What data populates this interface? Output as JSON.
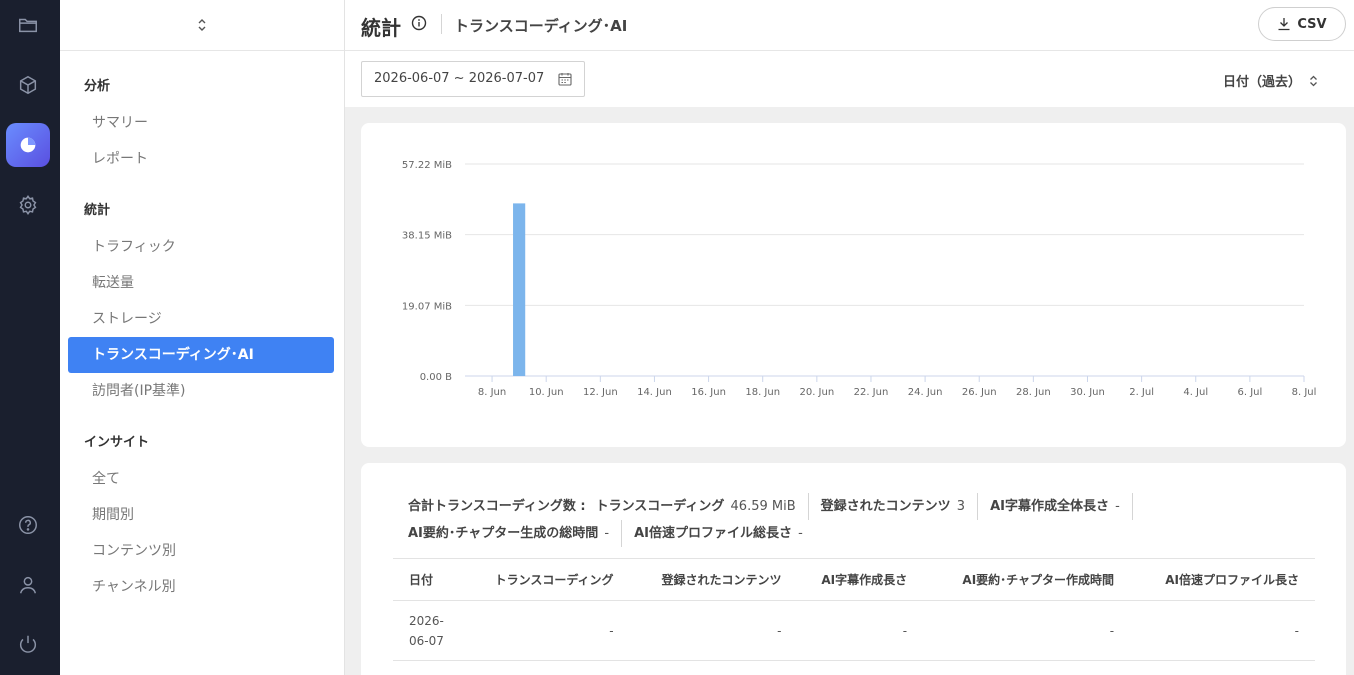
{
  "sidebar": {
    "sections": [
      {
        "title": "分析",
        "items": [
          "サマリー",
          "レポート"
        ]
      },
      {
        "title": "統計",
        "items": [
          "トラフィック",
          "転送量",
          "ストレージ",
          "トランスコーディング･AI",
          "訪問者(IP基準)"
        ]
      },
      {
        "title": "インサイト",
        "items": [
          "全て",
          "期間別",
          "コンテンツ別",
          "チャンネル別"
        ]
      }
    ],
    "active_item": "トランスコーディング･AI"
  },
  "header": {
    "title": "統計",
    "subtitle": "トランスコーディング･AI",
    "csv_label": "CSV"
  },
  "filter": {
    "date_range": "2026-06-07 ~ 2026-07-07",
    "sort_label": "日付（過去）"
  },
  "chart_data": {
    "type": "bar",
    "y_ticks": [
      "0.00 B",
      "19.07 MiB",
      "38.15 MiB",
      "57.22 MiB"
    ],
    "ylim": [
      0,
      57.22
    ],
    "x_ticks": [
      "8. Jun",
      "10. Jun",
      "12. Jun",
      "14. Jun",
      "16. Jun",
      "18. Jun",
      "20. Jun",
      "22. Jun",
      "24. Jun",
      "26. Jun",
      "28. Jun",
      "30. Jun",
      "2. Jul",
      "4. Jul",
      "6. Jul",
      "8. Jul"
    ],
    "series": [
      {
        "values": [
          {
            "x": "2026-06-09",
            "y": 46.59
          }
        ]
      }
    ],
    "bar_color": "#7cb5ec",
    "grid": true
  },
  "summary": {
    "lead": "合計トランスコーディング数 :",
    "items": [
      {
        "label": "トランスコーディング",
        "value": "46.59 MiB"
      },
      {
        "label": "登録されたコンテンツ",
        "value": "3"
      },
      {
        "label": "AI字幕作成全体長さ",
        "value": "-"
      },
      {
        "label": "AI要約･チャプター生成の総時間",
        "value": "-"
      },
      {
        "label": "AI倍速プロファイル総長さ",
        "value": "-"
      }
    ]
  },
  "table": {
    "columns": [
      "日付",
      "トランスコーディング",
      "登録されたコンテンツ",
      "AI字幕作成長さ",
      "AI要約･チャプター作成時間",
      "AI倍速プロファイル長さ"
    ],
    "rows": [
      [
        "2026-06-07",
        "-",
        "-",
        "-",
        "-",
        "-"
      ]
    ]
  }
}
